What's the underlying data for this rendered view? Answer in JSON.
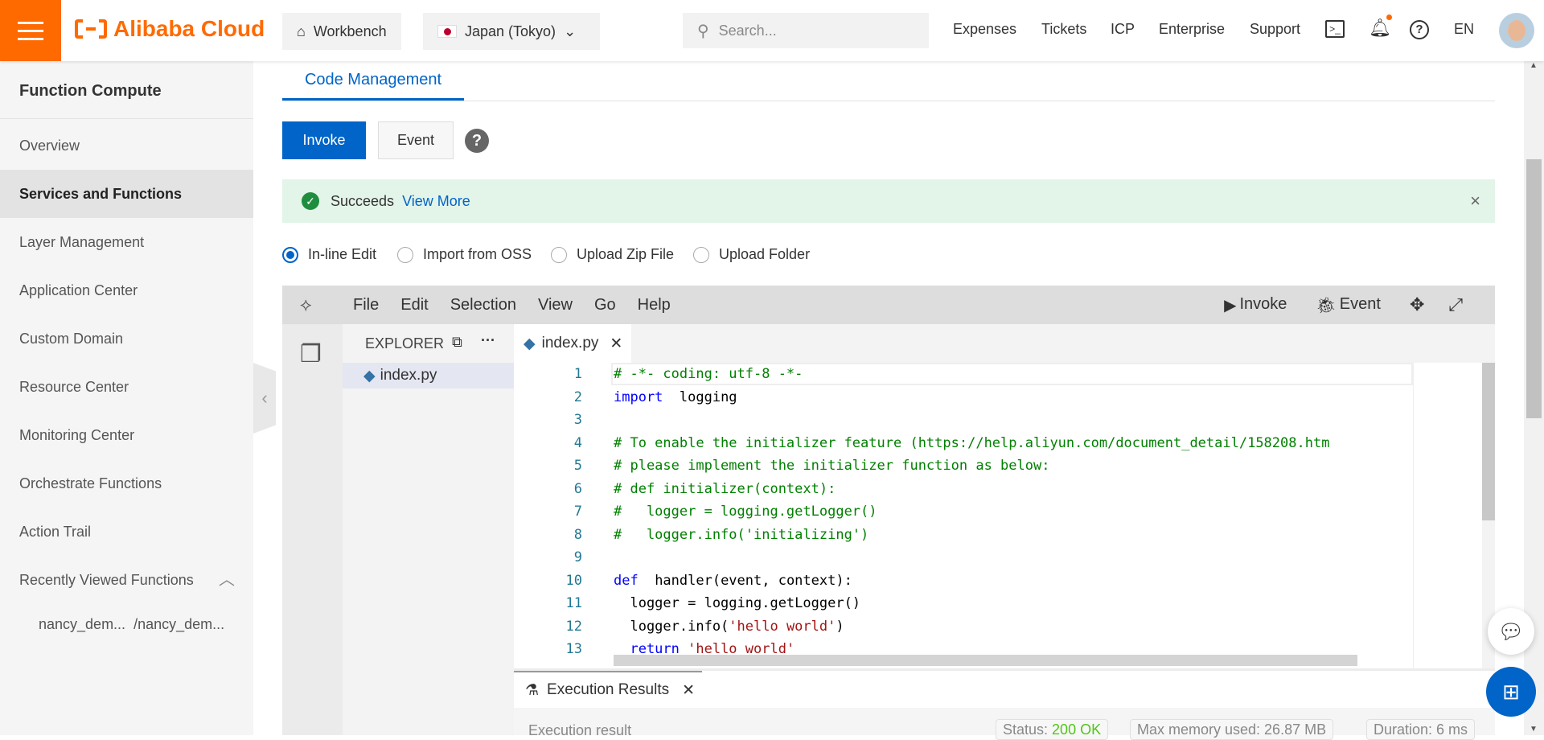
{
  "header": {
    "logo": "Alibaba Cloud",
    "workbench": "Workbench",
    "region": "Japan (Tokyo)",
    "search_placeholder": "Search...",
    "links": [
      "Expenses",
      "Tickets",
      "ICP",
      "Enterprise",
      "Support"
    ],
    "language": "EN",
    "brand_color": "#ff6a00"
  },
  "sidebar": {
    "title": "Function Compute",
    "items": [
      {
        "label": "Overview"
      },
      {
        "label": "Services and Functions",
        "active": true
      },
      {
        "label": "Layer Management"
      },
      {
        "label": "Application Center"
      },
      {
        "label": "Custom Domain"
      },
      {
        "label": "Resource Center"
      },
      {
        "label": "Monitoring Center"
      },
      {
        "label": "Orchestrate Functions"
      },
      {
        "label": "Action Trail"
      },
      {
        "label": "Recently Viewed Functions"
      }
    ],
    "recent": [
      "nancy_dem...",
      "/nancy_dem..."
    ]
  },
  "main": {
    "tab": "Code Management",
    "invoke": "Invoke",
    "event": "Event",
    "banner": {
      "status": "Succeeds",
      "link": "View More"
    },
    "radios": [
      {
        "label": "In-line Edit",
        "selected": true
      },
      {
        "label": "Import from OSS"
      },
      {
        "label": "Upload Zip File"
      },
      {
        "label": "Upload Folder"
      }
    ]
  },
  "editor": {
    "menu": [
      "File",
      "Edit",
      "Selection",
      "View",
      "Go",
      "Help"
    ],
    "invoke": "Invoke",
    "event": "Event",
    "explorer_title": "EXPLORER",
    "files": [
      "index.py"
    ],
    "open_tab": "index.py",
    "lines": [
      [
        [
          "cm",
          "# -*- coding: utf-8 -*-"
        ]
      ],
      [
        [
          "kw",
          "import"
        ],
        [
          "",
          "  logging"
        ]
      ],
      [],
      [
        [
          "cm",
          "# To enable the initializer feature (https://help.aliyun.com/document_detail/158208.htm"
        ]
      ],
      [
        [
          "cm",
          "# please implement the initializer function as below:"
        ]
      ],
      [
        [
          "cm",
          "# def initializer(context):"
        ]
      ],
      [
        [
          "cm",
          "#   logger = logging.getLogger()"
        ]
      ],
      [
        [
          "cm",
          "#   logger.info('initializing')"
        ]
      ],
      [],
      [
        [
          "kw",
          "def"
        ],
        [
          "",
          "  handler(event, context):"
        ]
      ],
      [
        [
          "",
          "  logger = logging.getLogger()"
        ]
      ],
      [
        [
          "",
          "  logger.info("
        ],
        [
          "st",
          "'hello world'"
        ],
        [
          "",
          ")"
        ]
      ],
      [
        [
          "kw",
          "  return"
        ],
        [
          "st",
          " 'hello world'"
        ]
      ]
    ]
  },
  "results": {
    "tab": "Execution Results",
    "label": "Execution result",
    "status_label": "Status:",
    "status_value": "200 OK",
    "memory": "Max memory used: 26.87 MB",
    "duration": "Duration: 6 ms"
  }
}
